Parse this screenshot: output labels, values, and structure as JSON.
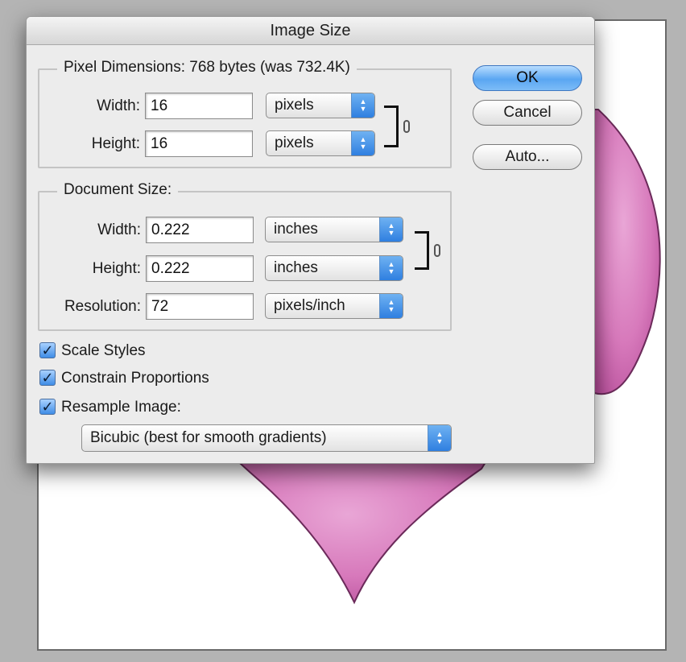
{
  "dialog": {
    "title": "Image Size"
  },
  "pixel_dimensions": {
    "title": "Pixel Dimensions:  768 bytes (was 732.4K)",
    "width_label": "Width:",
    "width_value": "16",
    "width_unit": "pixels",
    "height_label": "Height:",
    "height_value": "16",
    "height_unit": "pixels"
  },
  "document_size": {
    "title": "Document Size:",
    "width_label": "Width:",
    "width_value": "0.222",
    "width_unit": "inches",
    "height_label": "Height:",
    "height_value": "0.222",
    "height_unit": "inches",
    "resolution_label": "Resolution:",
    "resolution_value": "72",
    "resolution_unit": "pixels/inch"
  },
  "options": {
    "scale_styles": "Scale Styles",
    "constrain_proportions": "Constrain Proportions",
    "resample_image": "Resample Image:",
    "resample_method": "Bicubic (best for smooth gradients)"
  },
  "buttons": {
    "ok": "OK",
    "cancel": "Cancel",
    "auto": "Auto..."
  },
  "colors": {
    "accent": "#4a9bf0",
    "heart_fill": "#cf6cb0",
    "heart_outline": "#6b2a5a"
  }
}
